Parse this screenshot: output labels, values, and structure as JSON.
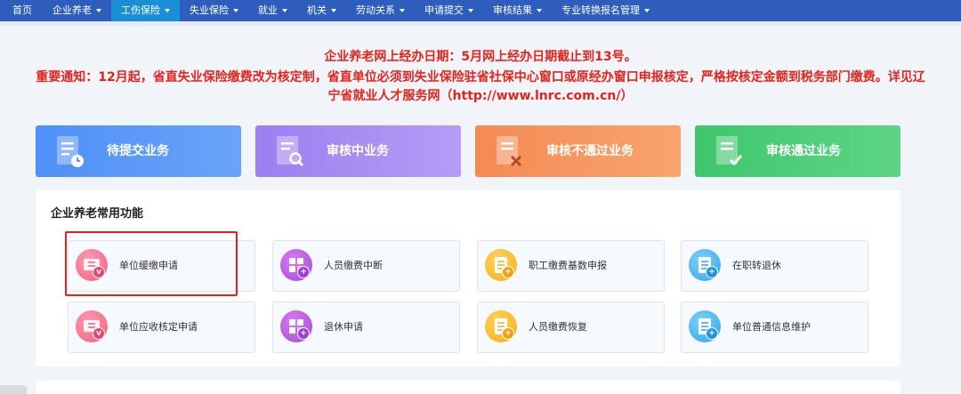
{
  "nav": {
    "items": [
      {
        "label": "首页",
        "dropdown": false,
        "active": false
      },
      {
        "label": "企业养老",
        "dropdown": true,
        "active": false
      },
      {
        "label": "工伤保险",
        "dropdown": true,
        "active": true
      },
      {
        "label": "失业保险",
        "dropdown": true,
        "active": false
      },
      {
        "label": "就业",
        "dropdown": true,
        "active": false
      },
      {
        "label": "机关",
        "dropdown": true,
        "active": false
      },
      {
        "label": "劳动关系",
        "dropdown": true,
        "active": false
      },
      {
        "label": "申请提交",
        "dropdown": true,
        "active": false
      },
      {
        "label": "审核结果",
        "dropdown": true,
        "active": false
      },
      {
        "label": "专业转换报名管理",
        "dropdown": true,
        "active": false
      }
    ]
  },
  "notice": {
    "line1": "企业养老网上经办日期：5月网上经办日期截止到13号。",
    "line2": "重要通知：12月起，省直失业保险缴费改为核定制，省直单位必须到失业保险驻省社保中心窗口或原经办窗口申报核定，严格按核定金额到税务部门缴费。详见辽宁省就业人才服务网（http://www.lnrc.com.cn/）",
    "color": "#e5231b"
  },
  "cards": [
    {
      "label": "待提交业务",
      "icon": "document-clock-icon"
    },
    {
      "label": "审核中业务",
      "icon": "document-search-icon"
    },
    {
      "label": "审核不通过业务",
      "icon": "document-x-icon"
    },
    {
      "label": "审核通过业务",
      "icon": "document-check-icon"
    }
  ],
  "panel": {
    "title": "企业养老常用功能",
    "functions": [
      {
        "label": "单位缓缴申请",
        "icon": "ticket-icon",
        "badge": "v"
      },
      {
        "label": "人员缴费中断",
        "icon": "grid-apps-icon",
        "badge": "+"
      },
      {
        "label": "职工缴费基数申报",
        "icon": "document-list-icon",
        "badge": "+"
      },
      {
        "label": "在职转退休",
        "icon": "list-icon",
        "badge": "+"
      },
      {
        "label": "单位应收核定申请",
        "icon": "ticket-icon",
        "badge": "v"
      },
      {
        "label": "退休申请",
        "icon": "grid-apps-icon",
        "badge": "+"
      },
      {
        "label": "人员缴费恢复",
        "icon": "document-list-icon",
        "badge": "+"
      },
      {
        "label": "单位普通信息维护",
        "icon": "list-icon",
        "badge": "+"
      }
    ]
  },
  "colors": {
    "nav_bg": "#2f5dbd",
    "nav_active": "#1b8fd6",
    "card_blue": "#4f90f7",
    "card_purple": "#9c7ff0",
    "card_orange": "#f58a55",
    "card_green": "#3fc66c",
    "highlight_border": "#e8201c"
  }
}
